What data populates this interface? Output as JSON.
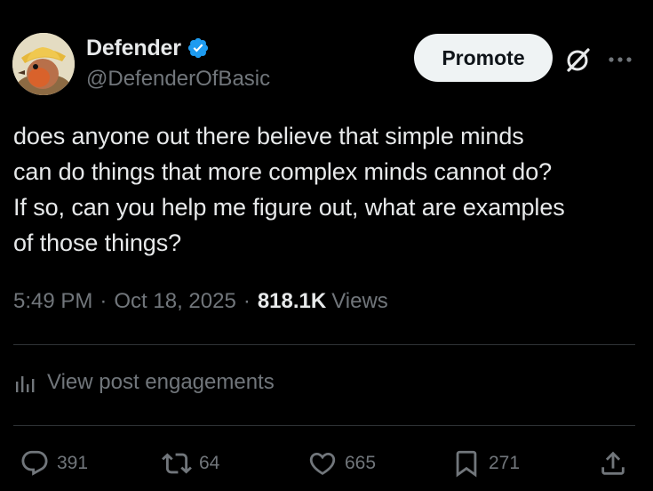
{
  "author": {
    "display_name": "Defender",
    "handle": "@DefenderOfBasic",
    "verified": true,
    "avatar_icon": "bird-with-hat-avatar"
  },
  "header_actions": {
    "promote_label": "Promote",
    "grok_icon": "grok-icon",
    "more_icon": "more-icon"
  },
  "post": {
    "text": "does anyone out there believe that simple minds\ncan do things that more complex minds cannot do?\nIf so, can you help me figure out, what are examples\nof those things?",
    "time": "5:49 PM",
    "date": "Oct 18, 2025",
    "views_count": "818.1K",
    "views_label": "Views",
    "separator": "·"
  },
  "engagements": {
    "label": "View post engagements",
    "icon": "analytics-icon"
  },
  "actions": {
    "replies": "391",
    "reposts": "64",
    "likes": "665",
    "bookmarks": "271"
  },
  "colors": {
    "background": "#000000",
    "text_primary": "#e7e9ea",
    "text_secondary": "#71767b",
    "verified_blue": "#1d9bf0",
    "divider": "#2f3336",
    "button_bg": "#eff3f4"
  }
}
